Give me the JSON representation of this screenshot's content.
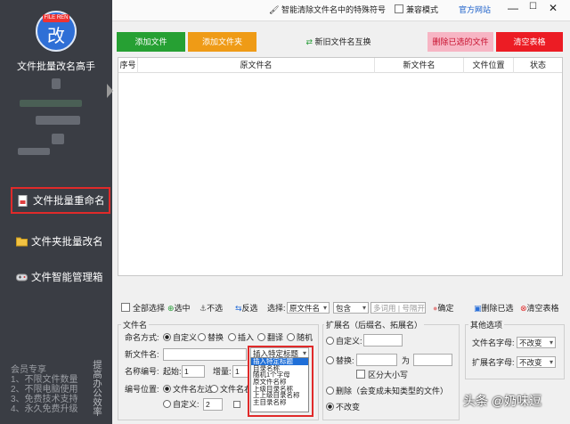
{
  "sidebar": {
    "logo_tag": "FILE REN",
    "logo_char": "改",
    "title": "文件批量改名高手",
    "nav": [
      {
        "label": "文件批量重命名",
        "icon": "document-icon"
      },
      {
        "label": "文件夹批量改名",
        "icon": "folder-icon"
      },
      {
        "label": "文件智能管理箱",
        "icon": "gamepad-icon"
      }
    ],
    "promo": [
      "会员专享",
      "1、不限文件数量",
      "2、不限电脑使用",
      "3、免费技术支持",
      "4、永久免费升级"
    ],
    "promo_side": "提高办公效率"
  },
  "topbar": {
    "clean_label": "智能清除文件名中的特殊符号",
    "compat_label": "兼容模式",
    "site_label": "官方网站"
  },
  "actions": {
    "add_file": "添加文件",
    "add_folder": "添加文件夹",
    "swap": "新旧文件名互换",
    "remove_selected": "删除已选的文件",
    "clear_table": "清空表格"
  },
  "table": {
    "headers": [
      "序号",
      "原文件名",
      "新文件名",
      "文件位置",
      "状态"
    ]
  },
  "toolbar": {
    "select_all": "全部选择",
    "select": "选中",
    "unselect": "不选",
    "invert": "反选",
    "choose_label": "选择:",
    "field_select": "原文件名",
    "cond_select": "包含",
    "search_placeholder": "多词用 | 号隔开",
    "confirm": "确定",
    "delete_selected": "删除已选",
    "clear_table": "清空表格"
  },
  "filename_panel": {
    "title": "文件名",
    "mode_label": "命名方式:",
    "modes": [
      "自定义",
      "替换",
      "插入",
      "翻译",
      "随机"
    ],
    "new_name_label": "新文件名:",
    "insert_select": "插入特定标题",
    "name_num_label": "名称编号:",
    "start_label": "起始:",
    "start_value": "1",
    "step_label": "增量:",
    "step_value": "1",
    "num_pos_label": "编号位置:",
    "num_pos_left": "文件名左边",
    "num_pos_right": "文件名右",
    "custom_label": "自定义:",
    "custom_value": "2"
  },
  "dropdown_options": [
    "插入特定标题",
    "目录名称",
    "随机1个字母",
    "原文件名称",
    "上级目录名称",
    "上上级目录名称",
    "主目录名称"
  ],
  "ext_panel": {
    "title": "扩展名（后缀名、拓展名）",
    "custom_label": "自定义:",
    "replace_label": "替换:",
    "to_label": "为",
    "case_label": "区分大小写",
    "delete_label": "删除（会变成未知类型的文件）",
    "keep_label": "不改变"
  },
  "other_panel": {
    "title": "其他选项",
    "filename_case_label": "文件名字母:",
    "filename_case_value": "不改变",
    "ext_case_label": "扩展名字母:",
    "ext_case_value": "不改变"
  },
  "watermark": "头条 @奶味逗",
  "colors": {
    "sidebar_bg": "#3a3d44",
    "add_file_btn": "#26a033",
    "add_folder_btn": "#ef9b16",
    "clear_btn": "#ec1c24",
    "highlight_box": "#e02a2a",
    "selection_blue": "#1f6fd8"
  }
}
